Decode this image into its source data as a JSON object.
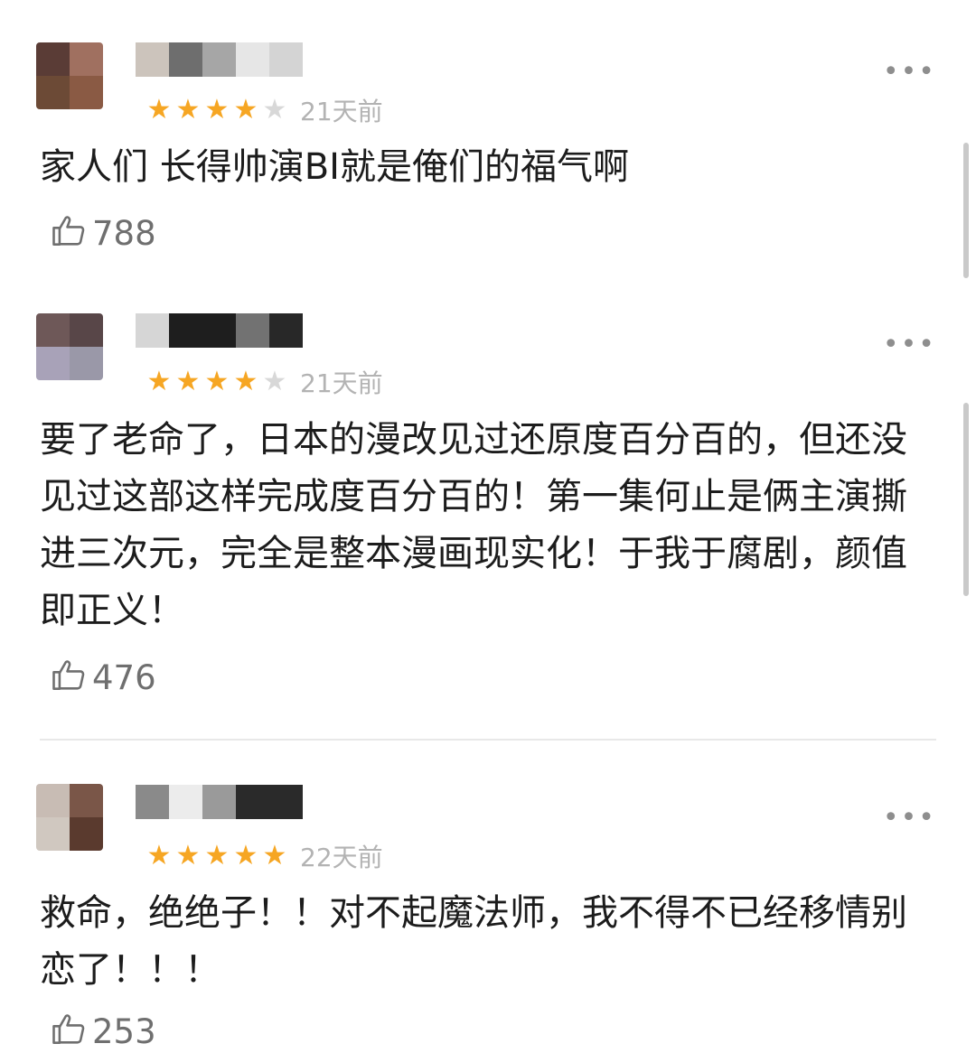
{
  "comments": [
    {
      "stars": 4,
      "time": "21天前",
      "text": "家人们 长得帅演BI就是俺们的福气啊",
      "likes": "788",
      "avatar_colors": [
        "#5a3c36",
        "#a07060",
        "#6c4a36",
        "#8a5a44"
      ],
      "name_colors": [
        "#ccc4bc",
        "#6e6e6e",
        "#a6a6a6",
        "#e6e6e6",
        "#d4d4d4"
      ]
    },
    {
      "stars": 4,
      "time": "21天前",
      "text": "要了老命了，日本的漫改见过还原度百分百的，但还没见过这部这样完成度百分百的！第一集何止是俩主演撕进三次元，完全是整本漫画现实化！于我于腐剧，颜值即正义！",
      "likes": "476",
      "avatar_colors": [
        "#6e5858",
        "#584648",
        "#a8a2b8",
        "#9a98a8"
      ],
      "name_colors": [
        "#d6d6d6",
        "#1e1e1e",
        "#1e1e1e",
        "#727272",
        "#282828"
      ]
    },
    {
      "stars": 5,
      "time": "22天前",
      "text": "救命，绝绝子！！对不起魔法师，我不得不已经移情别恋了！！！",
      "likes": "253",
      "avatar_colors": [
        "#c8bcb4",
        "#7a5648",
        "#d0c8c0",
        "#5a3a2e"
      ],
      "name_colors": [
        "#8a8a8a",
        "#ececec",
        "#9a9a9a",
        "#2a2a2a",
        "#2a2a2a"
      ]
    }
  ],
  "icons": {
    "more": "more-icon",
    "like": "thumbs-up-icon",
    "star": "star-icon"
  },
  "colors": {
    "star_on": "#f6a623",
    "star_off": "#d8d8d8"
  }
}
